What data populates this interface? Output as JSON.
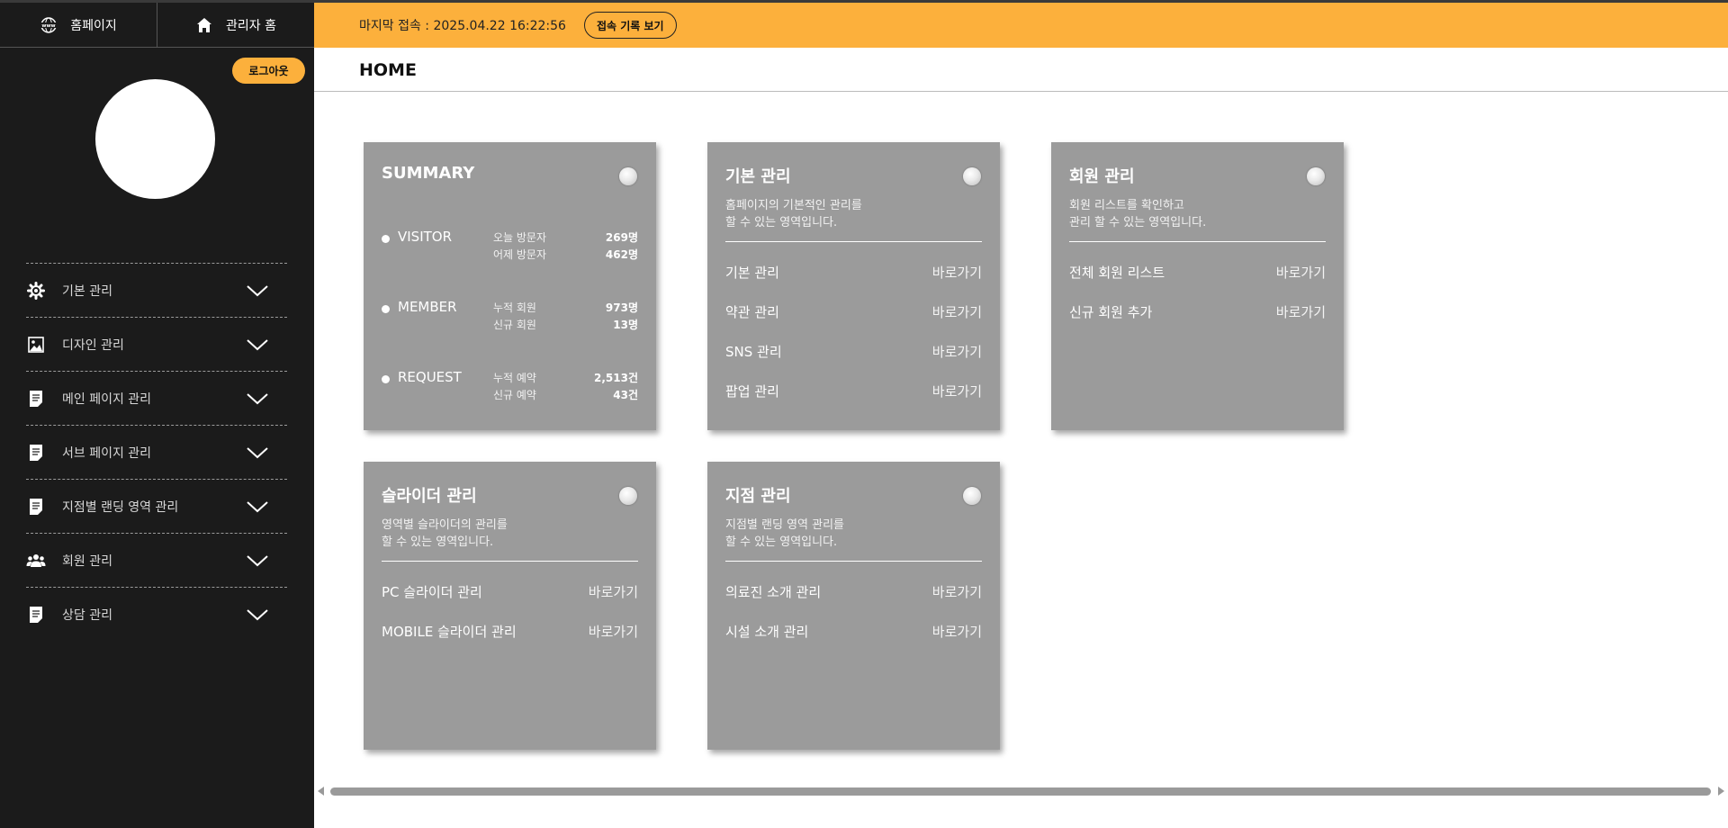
{
  "sidebar": {
    "home_link": "홈페이지",
    "admin_home": "관리자 홈",
    "logout": "로그아웃",
    "menu": [
      {
        "label": "기본 관리",
        "icon": "gear-icon"
      },
      {
        "label": "디자인 관리",
        "icon": "image-icon"
      },
      {
        "label": "메인 페이지 관리",
        "icon": "document-icon"
      },
      {
        "label": "서브 페이지 관리",
        "icon": "document-icon"
      },
      {
        "label": "지점별 랜딩 영역 관리",
        "icon": "document-icon"
      },
      {
        "label": "회원 관리",
        "icon": "users-icon"
      },
      {
        "label": "상담 관리",
        "icon": "document-icon"
      }
    ]
  },
  "topbar": {
    "last_login": "마지막 접속 : 2025.04.22 16:22:56",
    "log_button": "접속 기록 보기"
  },
  "page_title": "HOME",
  "summary": {
    "title": "SUMMARY",
    "rows": [
      {
        "category": "VISITOR",
        "items": [
          {
            "label": "오늘 방문자",
            "value": "269명"
          },
          {
            "label": "어제 방문자",
            "value": "462명"
          }
        ]
      },
      {
        "category": "MEMBER",
        "items": [
          {
            "label": "누적 회원",
            "value": "973명"
          },
          {
            "label": "신규 회원",
            "value": "13명"
          }
        ]
      },
      {
        "category": "REQUEST",
        "items": [
          {
            "label": "누적 예약",
            "value": "2,513건"
          },
          {
            "label": "신규 예약",
            "value": "43건"
          }
        ]
      }
    ]
  },
  "cards": [
    {
      "title": "기본 관리",
      "desc1": "홈페이지의 기본적인 관리를",
      "desc2": "할 수 있는 영역입니다.",
      "links": [
        {
          "label": "기본 관리",
          "go": "바로가기"
        },
        {
          "label": "약관 관리",
          "go": "바로가기"
        },
        {
          "label": "SNS 관리",
          "go": "바로가기"
        },
        {
          "label": "팝업 관리",
          "go": "바로가기"
        }
      ]
    },
    {
      "title": "회원 관리",
      "desc1": "회원 리스트를 확인하고",
      "desc2": "관리 할 수 있는 영역입니다.",
      "links": [
        {
          "label": "전체 회원 리스트",
          "go": "바로가기"
        },
        {
          "label": "신규 회원 추가",
          "go": "바로가기"
        }
      ]
    },
    {
      "title": "슬라이더 관리",
      "desc1": "영역별 슬라이더의 관리를",
      "desc2": "할 수 있는 영역입니다.",
      "links": [
        {
          "label": "PC 슬라이더 관리",
          "go": "바로가기"
        },
        {
          "label": "MOBILE 슬라이더 관리",
          "go": "바로가기"
        }
      ]
    },
    {
      "title": "지점 관리",
      "desc1": "지점별 랜딩 영역 관리를",
      "desc2": "할 수 있는 영역입니다.",
      "links": [
        {
          "label": "의료진 소개 관리",
          "go": "바로가기"
        },
        {
          "label": "시설 소개 관리",
          "go": "바로가기"
        }
      ]
    }
  ],
  "colors": {
    "accent": "#fcb03c",
    "sidebar": "#1b1b1b",
    "card": "#9b9b9b"
  }
}
